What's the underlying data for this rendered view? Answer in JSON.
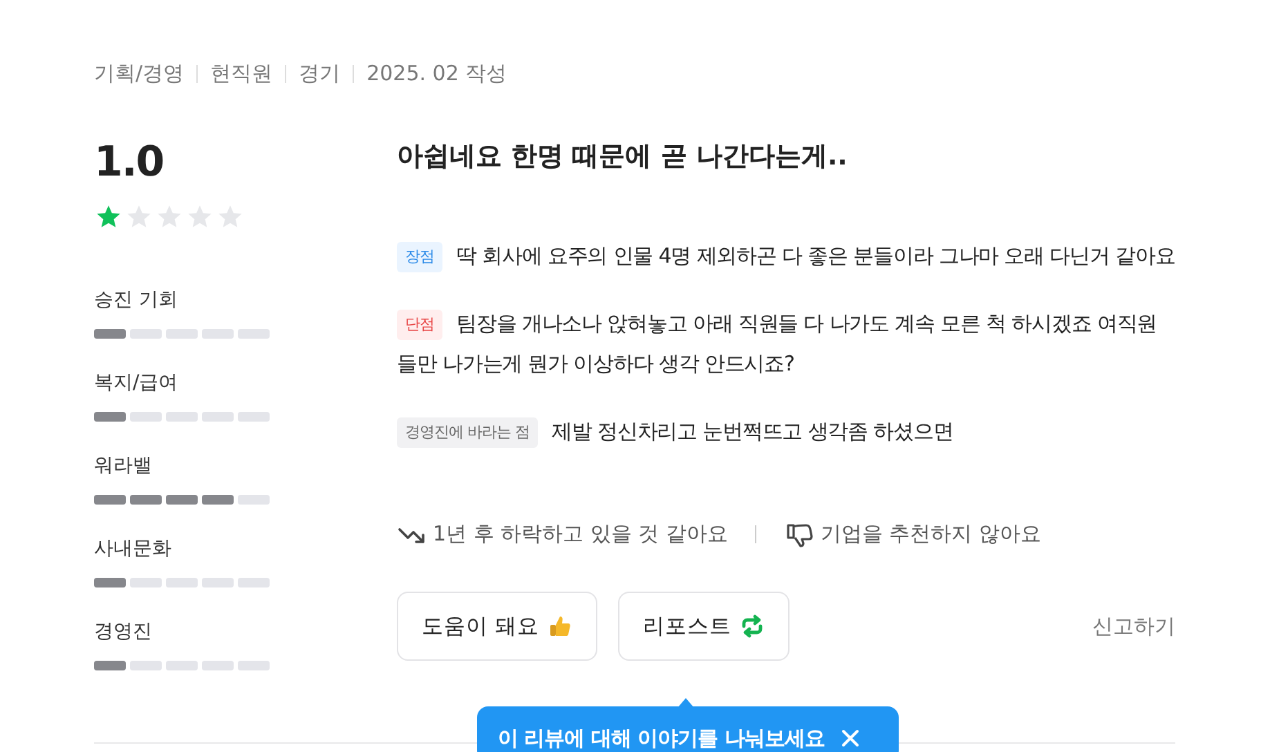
{
  "meta": [
    "기획/경영",
    "현직원",
    "경기",
    "2025. 02 작성"
  ],
  "score": "1.0",
  "stars": 1,
  "ratings": [
    {
      "label": "승진 기회",
      "level": 0.2
    },
    {
      "label": "복지/급여",
      "level": 0.2
    },
    {
      "label": "워라밸",
      "level": 0.8
    },
    {
      "label": "사내문화",
      "level": 0.2
    },
    {
      "label": "경영진",
      "level": 0.2
    }
  ],
  "title": "아쉽네요 한명 때문에 곧 나간다는게..",
  "sections": [
    {
      "kind": "pros",
      "tag": "장점",
      "text": "딱 회사에 요주의 인물 4명 제외하곤 다 좋은 분들이라 그나마 오래 다닌거 같아요"
    },
    {
      "kind": "cons",
      "tag": "단점",
      "text": "팀장을 개나소나 앉혀놓고 아래 직원들 다 나가도 계속 모른 척 하시겠죠 여직원들만 나가는게 뭔가 이상하다 생각 안드시죠?"
    },
    {
      "kind": "wish",
      "tag": "경영진에 바라는 점",
      "text": "제발 정신차리고 눈번쩍뜨고 생각좀 하셨으면"
    }
  ],
  "outlook": "1년 후 하락하고 있을 것 같아요",
  "recommend": "기업을 추천하지 않아요",
  "buttons": [
    {
      "kind": "helpful",
      "label": "도움이 돼요"
    },
    {
      "kind": "repost",
      "label": "리포스트"
    }
  ],
  "report": "신고하기",
  "tooltip": "이 리뷰에 대해 이야기를 나눠보세요"
}
